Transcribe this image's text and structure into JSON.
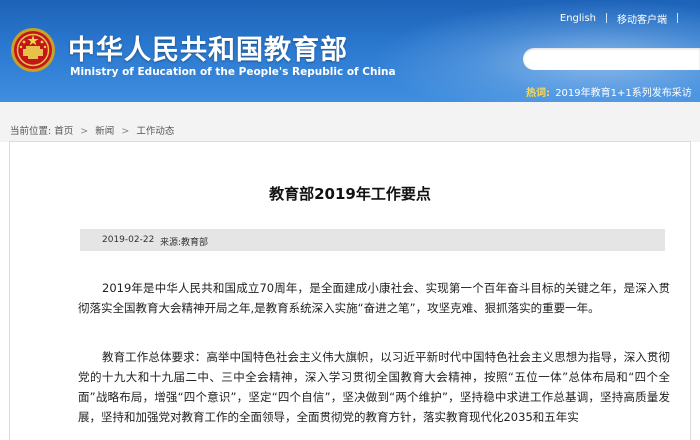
{
  "header": {
    "title": "中华人民共和国教育部",
    "subtitle": "Ministry of Education of the People's Republic of China",
    "links": [
      "English",
      "移动客户端"
    ],
    "search_placeholder": "",
    "hot_label": "热词:",
    "hot_item": "2019年教育1+1系列发布采访"
  },
  "breadcrumb": {
    "label": "当前位置:",
    "items": [
      "首页",
      "新闻",
      "工作动态"
    ],
    "separator": ">"
  },
  "article": {
    "title": "教育部2019年工作要点",
    "date": "2019-02-22",
    "source": "来源:教育部",
    "paragraphs": [
      "2019年是中华人民共和国成立70周年，是全面建成小康社会、实现第一个百年奋斗目标的关键之年，是深入贯彻落实全国教育大会精神开局之年,是教育系统深入实施“奋进之笔”，攻坚克难、狠抓落实的重要一年。",
      "教育工作总体要求：高举中国特色社会主义伟大旗帜，以习近平新时代中国特色社会主义思想为指导，深入贯彻党的十九大和十九届二中、三中全会精神，深入学习贯彻全国教育大会精神，按照“五位一体”总体布局和“四个全面”战略布局，增强“四个意识”，坚定“四个自信”，坚决做到“两个维护”，坚持稳中求进工作总基调，坚持高质量发展，坚持和加强党对教育工作的全面领导，全面贯彻党的教育方针，落实教育现代化2035和五年实"
    ]
  },
  "colors": {
    "header_blue": "#2a78cf",
    "hot_label": "#ffd94a",
    "meta_bg": "#e5e5e5"
  }
}
